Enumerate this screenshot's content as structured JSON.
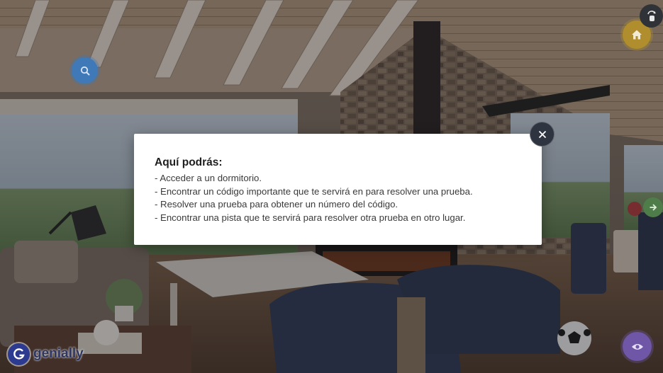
{
  "dialog": {
    "title": "Aquí podrás:",
    "lines": [
      "- Acceder a un dormitorio.",
      "- Encontrar un código importante que te servirá en para resolver una prueba.",
      "- Resolver una prueba para obtener un número del código.",
      "- Encontrar una pista que te servirá para resolver otra prueba en otro lugar."
    ]
  },
  "branding": {
    "logo_text": "genially"
  },
  "icons": {
    "search": "search-icon",
    "home": "home-icon",
    "rotate": "touch-rotate-icon",
    "next": "arrow-right-icon",
    "view": "eye-icon",
    "close": "close-icon"
  },
  "colors": {
    "search_button": "#3f79b8",
    "home_button": "#b08e2e",
    "view_button": "#6f56a6",
    "next_button": "#4f7d4a",
    "overlay": "rgba(20,20,30,0.38)"
  }
}
